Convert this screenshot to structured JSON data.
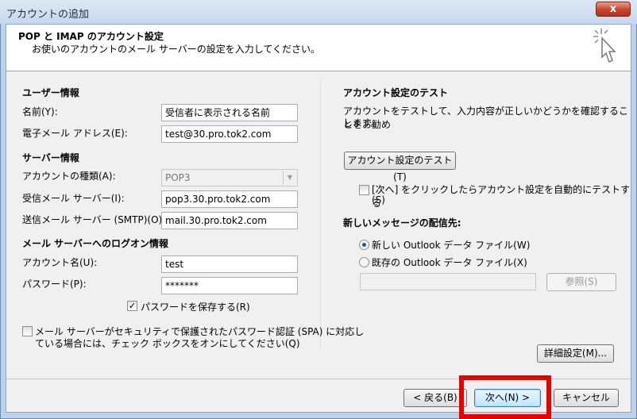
{
  "window": {
    "title": "アカウントの追加",
    "close_glyph": "x"
  },
  "header": {
    "title": "POP と IMAP のアカウント設定",
    "subtitle": "お使いのアカウントのメール サーバーの設定を入力してください。"
  },
  "user_info": {
    "section": "ユーザー情報",
    "name_label": "名前(Y):",
    "name_value": "受信者に表示される名前",
    "email_label": "電子メール アドレス(E):",
    "email_value": "test@30.pro.tok2.com"
  },
  "server_info": {
    "section": "サーバー情報",
    "type_label": "アカウントの種類(A):",
    "type_value": "POP3",
    "incoming_label": "受信メール サーバー(I):",
    "incoming_value": "pop3.30.pro.tok2.com",
    "outgoing_label": "送信メール サーバー (SMTP)(O):",
    "outgoing_value": "mail.30.pro.tok2.com"
  },
  "logon": {
    "section": "メール サーバーへのログオン情報",
    "account_label": "アカウント名(U):",
    "account_value": "test",
    "password_label": "パスワード(P):",
    "password_value": "*******",
    "remember_label": "パスワードを保存する(R)",
    "remember_checked": true,
    "spa_line1": "メール サーバーがセキュリティで保護されたパスワード認証 (SPA) に対応し",
    "spa_line2": "ている場合には、チェック ボックスをオンにしてください(Q)",
    "spa_checked": false
  },
  "test": {
    "section": "アカウント設定のテスト",
    "desc_line1": "アカウントをテストして、入力内容が正しいかどうかを確認することをお勧め",
    "desc_line2": "します。",
    "button": "アカウント設定のテスト(T)",
    "auto_line1": "[次へ] をクリックしたらアカウント設定を自動的にテストする",
    "auto_line2": "(S)",
    "auto_checked": false
  },
  "delivery": {
    "section": "新しいメッセージの配信先:",
    "opt_new": "新しい Outlook データ ファイル(W)",
    "opt_existing": "既存の Outlook データ ファイル(X)",
    "selected": "new",
    "existing_path": "",
    "browse": "参照(S)"
  },
  "advanced_button": "詳細設定(M)...",
  "footer": {
    "back": "< 戻る(B)",
    "next": "次へ(N) >",
    "cancel": "キャンセル"
  },
  "colors": {
    "highlight": "#e60000",
    "close": "#c7432a"
  }
}
